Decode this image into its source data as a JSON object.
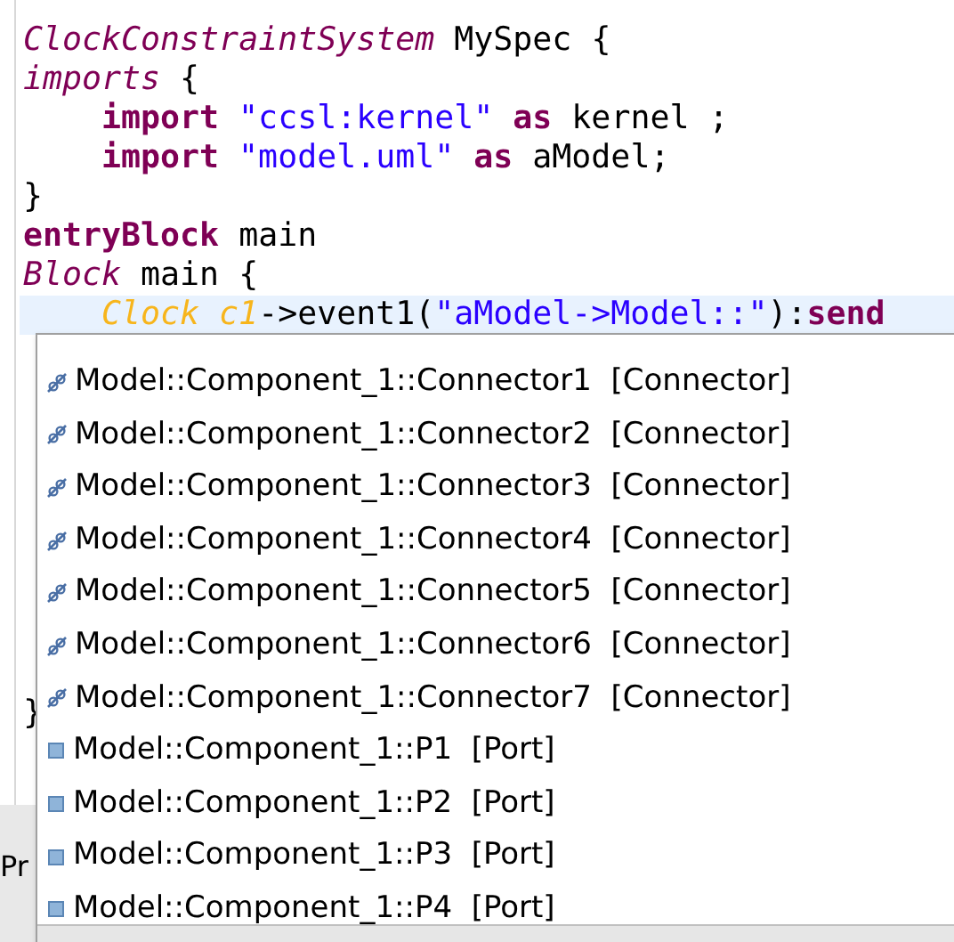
{
  "code_lines": [
    {
      "indented": false,
      "highlighted": false,
      "tokens": [
        {
          "kind": "keyword-italic",
          "text": "ClockConstraintSystem"
        },
        {
          "kind": "plain",
          "text": " MySpec {"
        }
      ]
    },
    {
      "indented": false,
      "highlighted": false,
      "tokens": [
        {
          "kind": "keyword-italic",
          "text": "imports"
        },
        {
          "kind": "plain",
          "text": " {"
        }
      ]
    },
    {
      "indented": true,
      "highlighted": false,
      "tokens": [
        {
          "kind": "keyword",
          "text": "import"
        },
        {
          "kind": "string",
          "text": " \"ccsl:kernel\""
        },
        {
          "kind": "keyword",
          "text": " as"
        },
        {
          "kind": "plain",
          "text": " kernel ;"
        }
      ]
    },
    {
      "indented": true,
      "highlighted": false,
      "tokens": [
        {
          "kind": "keyword",
          "text": "import"
        },
        {
          "kind": "string",
          "text": " \"model.uml\""
        },
        {
          "kind": "keyword",
          "text": " as"
        },
        {
          "kind": "plain",
          "text": " aModel;"
        }
      ]
    },
    {
      "indented": false,
      "highlighted": false,
      "tokens": [
        {
          "kind": "plain",
          "text": "}"
        }
      ]
    },
    {
      "indented": false,
      "highlighted": false,
      "tokens": [
        {
          "kind": "keyword",
          "text": "entryBlock"
        },
        {
          "kind": "plain",
          "text": " main"
        }
      ]
    },
    {
      "indented": false,
      "highlighted": false,
      "tokens": [
        {
          "kind": "keyword-italic",
          "text": "Block"
        },
        {
          "kind": "plain",
          "text": " main {"
        }
      ]
    },
    {
      "indented": true,
      "highlighted": true,
      "tokens": [
        {
          "kind": "type",
          "text": "Clock c1"
        },
        {
          "kind": "plain",
          "text": "->event1("
        },
        {
          "kind": "string",
          "text": "\"aModel->Model::\""
        },
        {
          "kind": "plain",
          "text": "):"
        },
        {
          "kind": "keyword",
          "text": "send"
        }
      ]
    }
  ],
  "hidden_brace": "}",
  "hidden_tab": "Pr",
  "completions": [
    {
      "kind": "connector",
      "label": "Model::Component_1::Connector1  [Connector]",
      "selected": false
    },
    {
      "kind": "connector",
      "label": "Model::Component_1::Connector2  [Connector]",
      "selected": false
    },
    {
      "kind": "connector",
      "label": "Model::Component_1::Connector3  [Connector]",
      "selected": false
    },
    {
      "kind": "connector",
      "label": "Model::Component_1::Connector4  [Connector]",
      "selected": false
    },
    {
      "kind": "connector",
      "label": "Model::Component_1::Connector5  [Connector]",
      "selected": false
    },
    {
      "kind": "connector",
      "label": "Model::Component_1::Connector6  [Connector]",
      "selected": false
    },
    {
      "kind": "connector",
      "label": "Model::Component_1::Connector7  [Connector]",
      "selected": false
    },
    {
      "kind": "port",
      "label": "Model::Component_1::P1  [Port]",
      "selected": false
    },
    {
      "kind": "port",
      "label": "Model::Component_1::P2  [Port]",
      "selected": false
    },
    {
      "kind": "port",
      "label": "Model::Component_1::P3  [Port]",
      "selected": false
    },
    {
      "kind": "port",
      "label": "Model::Component_1::P4  [Port]",
      "selected": false
    }
  ]
}
